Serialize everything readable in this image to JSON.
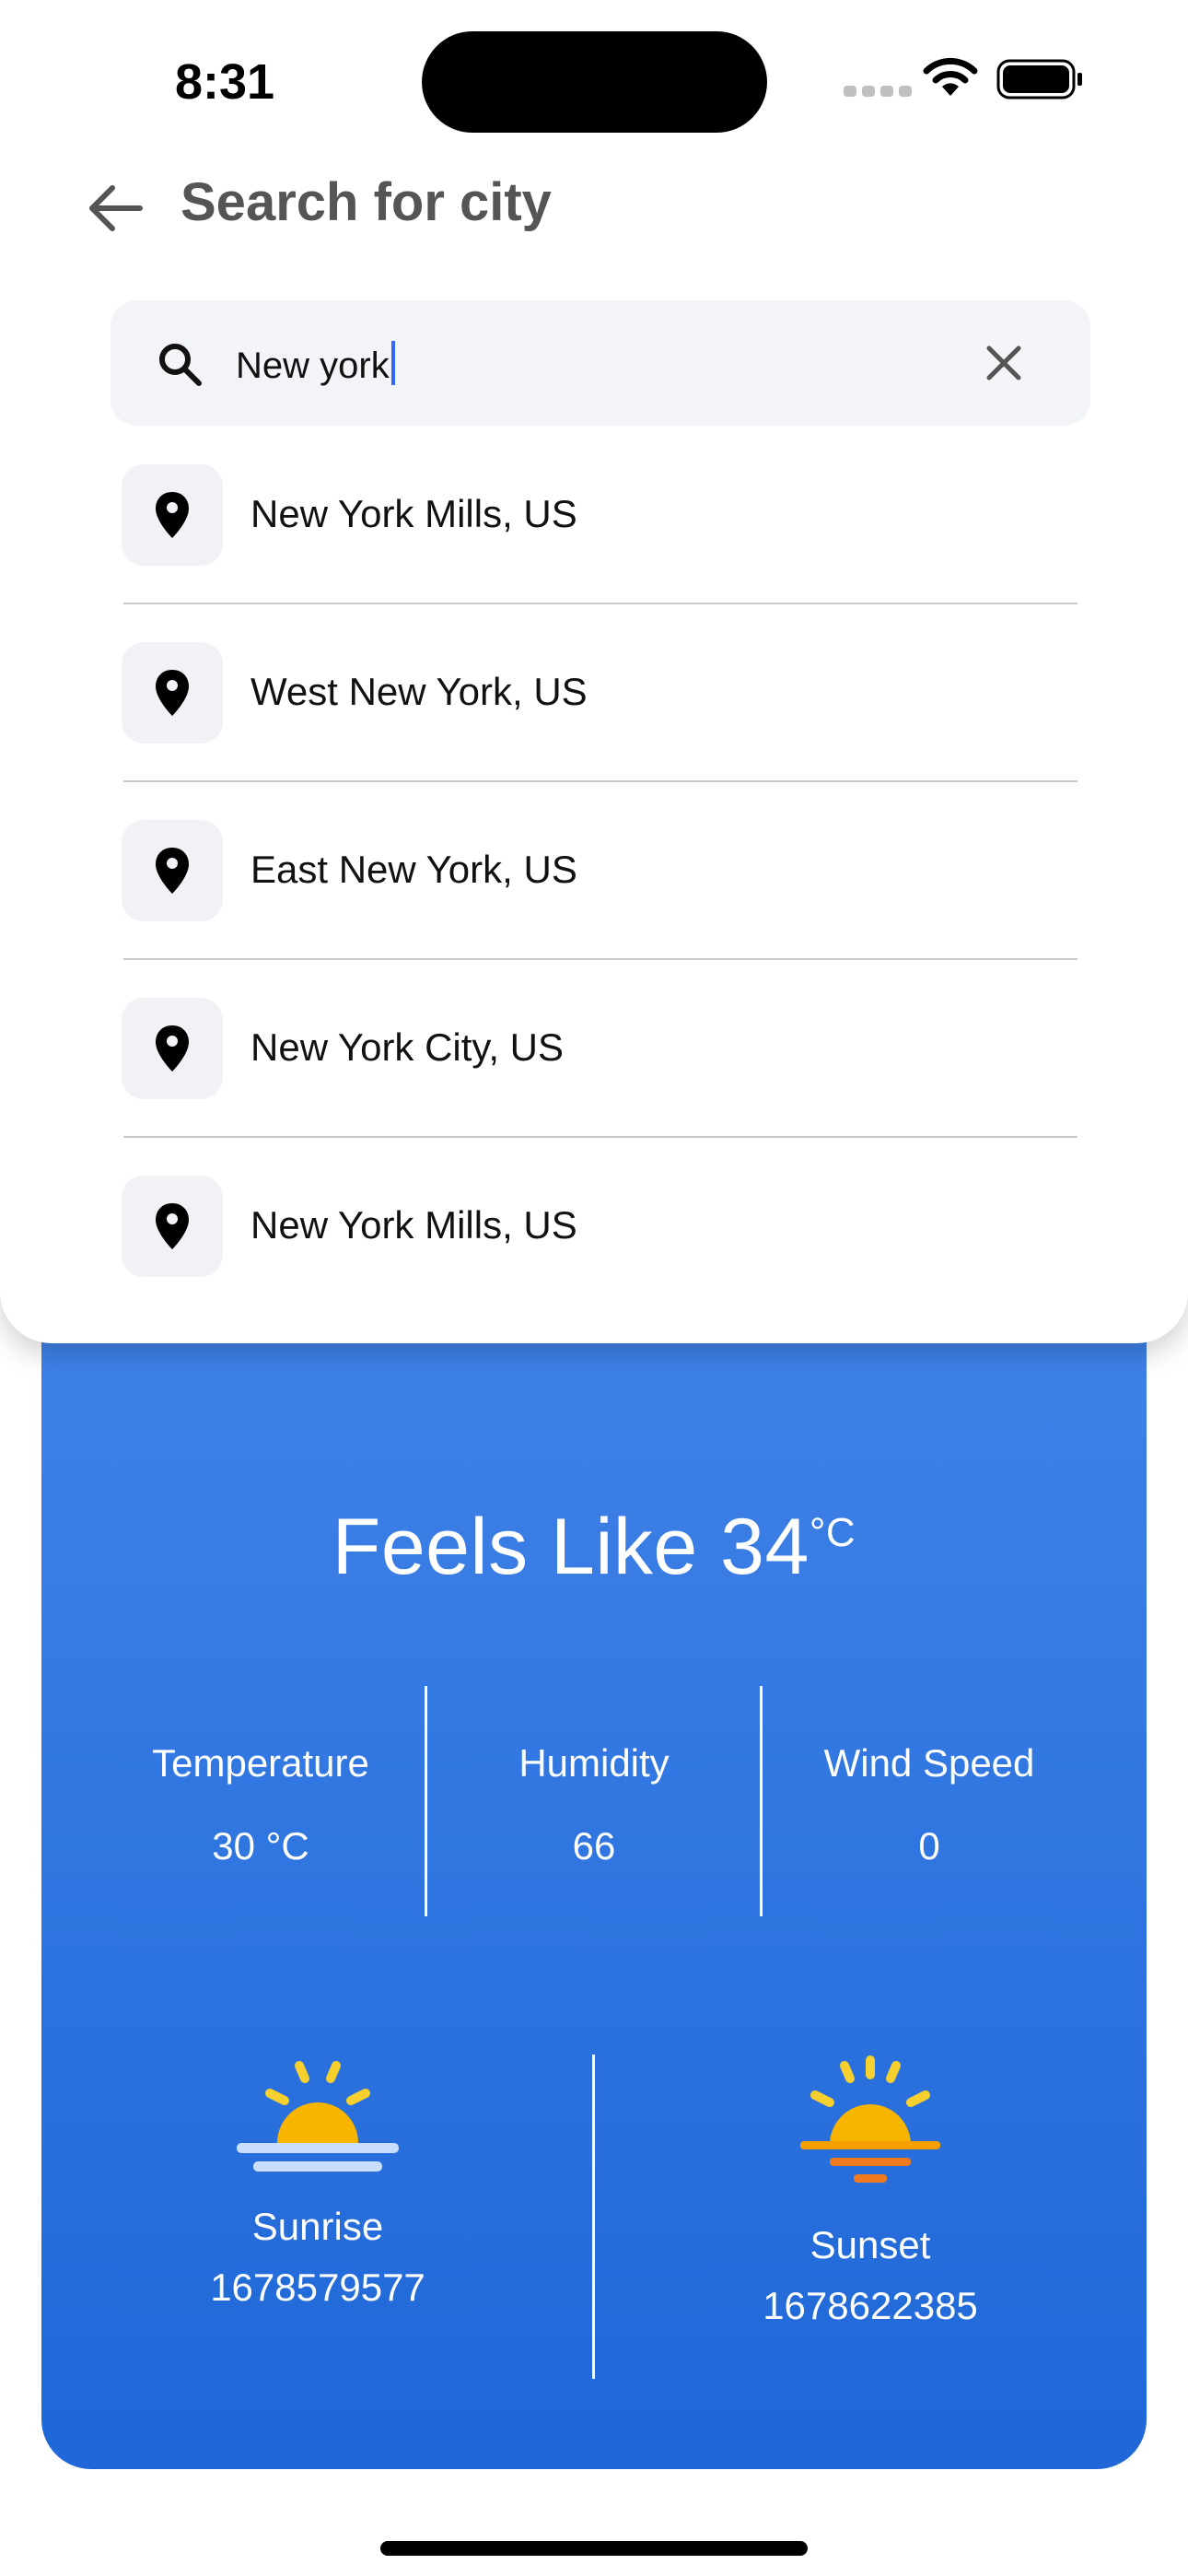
{
  "status_bar": {
    "time": "8:31"
  },
  "header": {
    "title": "Search for city"
  },
  "search": {
    "value": "New york"
  },
  "results": [
    {
      "label": "New York Mills, US"
    },
    {
      "label": "West New York, US"
    },
    {
      "label": "East New York, US"
    },
    {
      "label": "New York City, US"
    },
    {
      "label": "New York Mills, US"
    }
  ],
  "weather": {
    "feels_like_prefix": "Feels Like 34",
    "feels_like_unit": "°C",
    "stats": [
      {
        "label": "Temperature",
        "value": "30 °C"
      },
      {
        "label": "Humidity",
        "value": "66"
      },
      {
        "label": "Wind Speed",
        "value": "0"
      }
    ],
    "sunrise": {
      "label": "Sunrise",
      "value": "1678579577"
    },
    "sunset": {
      "label": "Sunset",
      "value": "1678622385"
    }
  },
  "colors": {
    "card_top": "#4083e8",
    "card_bottom": "#1f67d8",
    "sun": "#f7b500",
    "caret": "#3366ff"
  },
  "icons": {
    "back": "arrow-left-icon",
    "search": "search-icon",
    "clear": "close-icon",
    "result": "map-pin-icon"
  }
}
